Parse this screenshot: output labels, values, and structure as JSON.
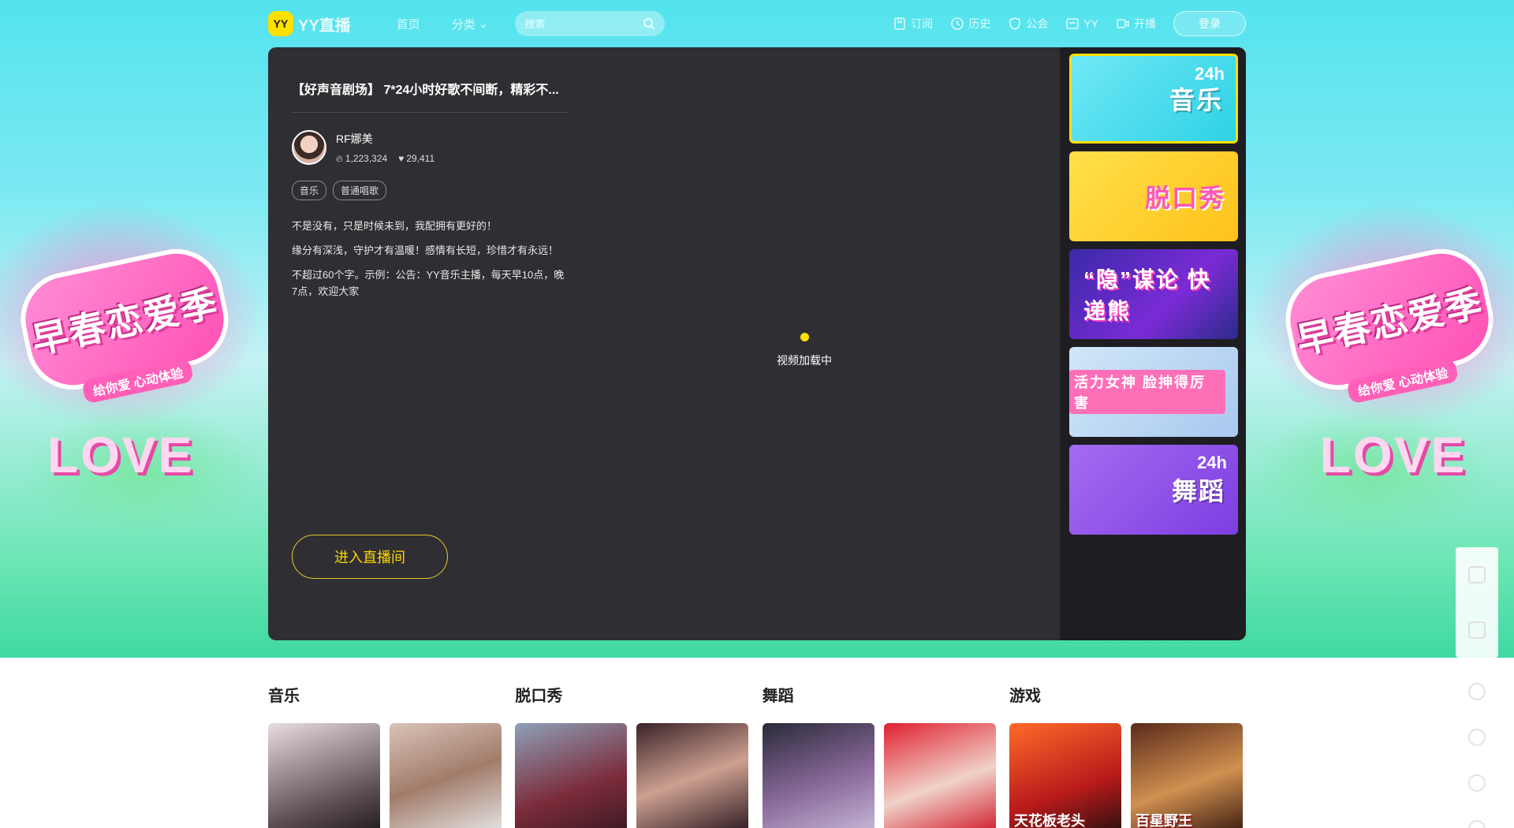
{
  "nav": {
    "logo_badge": "YY",
    "logo_text": "YY直播",
    "home": "首页",
    "category": "分类",
    "search_placeholder": "搜索",
    "subscribe": "订阅",
    "history": "历史",
    "guild": "公会",
    "yy": "YY",
    "broadcast": "开播",
    "login": "登录"
  },
  "hero": {
    "banner_text": "早春恋爱季",
    "banner_sub": "给你爱 心动体验",
    "love_text": "LOVE"
  },
  "room": {
    "title": "【好声音剧场】 7*24小时好歌不间断，精彩不...",
    "anchor_name": "RF娜美",
    "popularity": "1,223,324",
    "likes": "29,411",
    "tags": [
      "音乐",
      "普通唱歌"
    ],
    "desc": [
      "不是没有，只是时候未到，我配拥有更好的！",
      "缘分有深浅，守护才有温暖！感情有长短，珍惜才有永远！",
      "不超过60个字。示例：公告：YY音乐主播，每天早10点，晚7点，欢迎大家"
    ],
    "loading_text": "视频加载中",
    "enter_button": "进入直播间"
  },
  "sidebar": {
    "items": [
      {
        "label": "音乐",
        "sub": "24h"
      },
      {
        "label": "脱口秀",
        "sub": ""
      },
      {
        "label": "“隐”谋论 快递熊",
        "sub": ""
      },
      {
        "label": "活力女神 脸抻得厉害",
        "sub": ""
      },
      {
        "label": "舞蹈",
        "sub": "24h"
      }
    ]
  },
  "categories": [
    {
      "title": "音乐",
      "cards": [
        "",
        ""
      ]
    },
    {
      "title": "脱口秀",
      "cards": [
        "",
        ""
      ]
    },
    {
      "title": "舞蹈",
      "cards": [
        "",
        ""
      ]
    },
    {
      "title": "游戏",
      "cards": [
        "天花板老头",
        "百星野王"
      ]
    }
  ],
  "colors": {
    "accent": "#ffe000",
    "panel_bg": "#2f2f33",
    "sidebar_bg": "#1e1e22",
    "button_text": "#ffd700"
  }
}
